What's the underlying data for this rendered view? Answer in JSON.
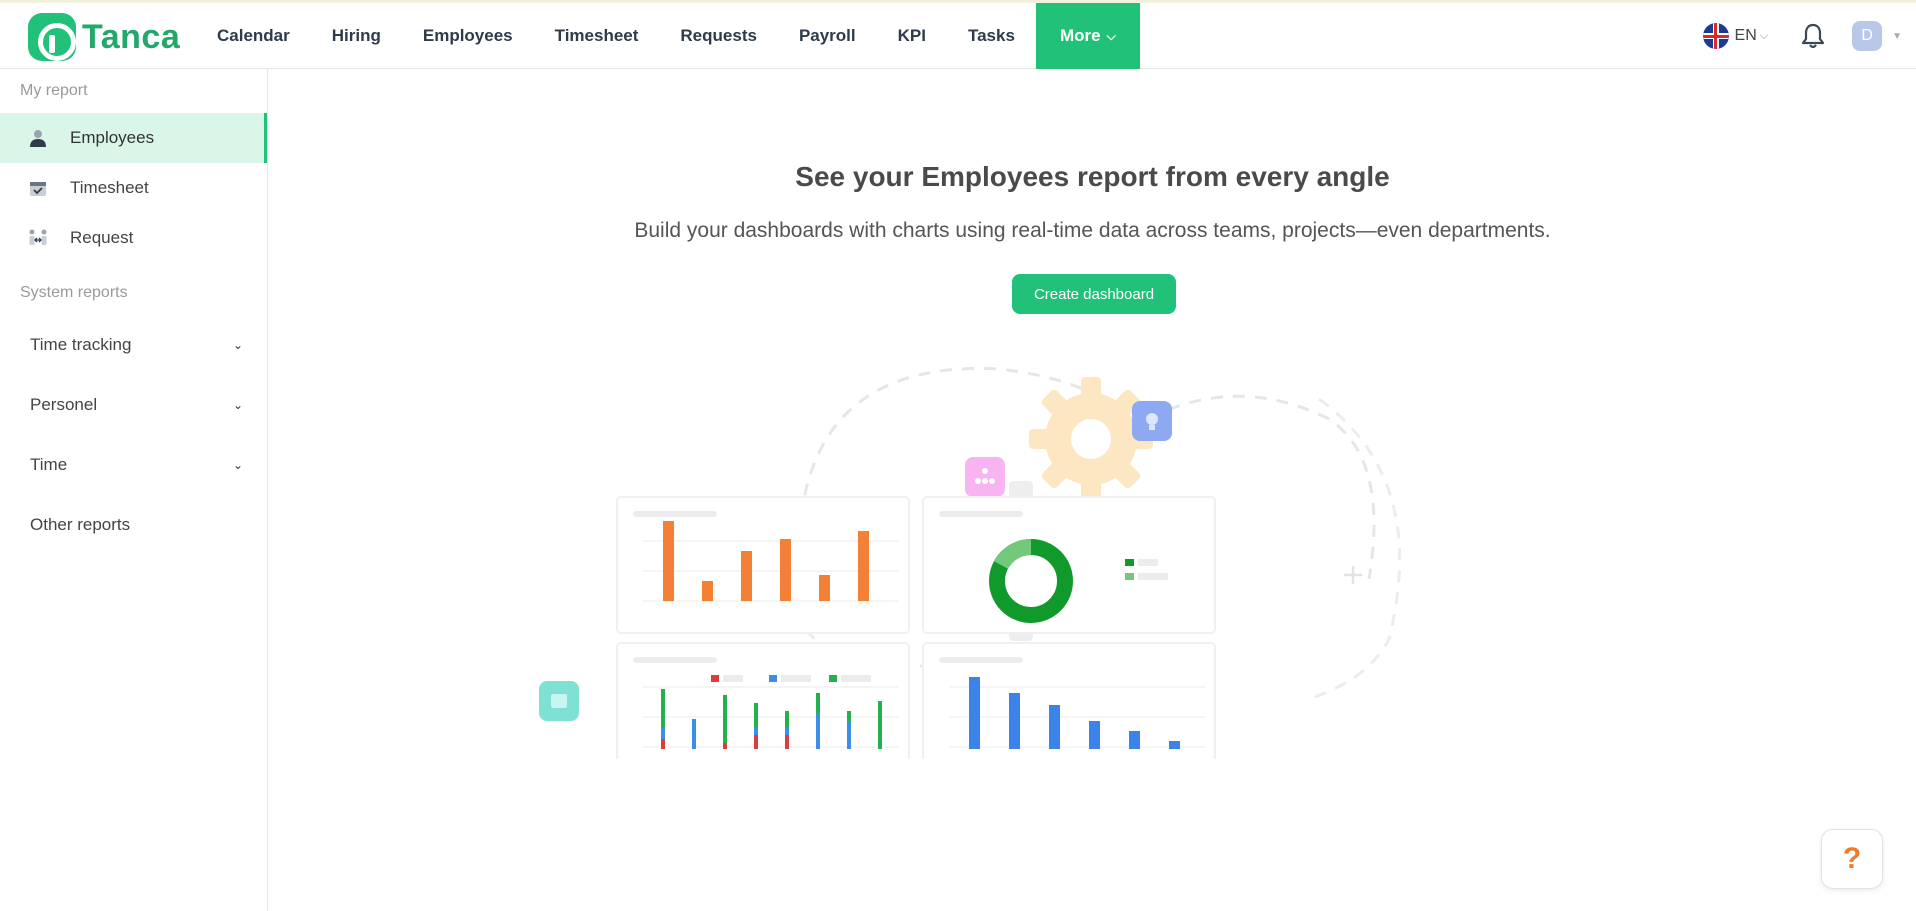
{
  "brand": {
    "name": "Tanca"
  },
  "nav": {
    "items": [
      {
        "label": "Calendar"
      },
      {
        "label": "Hiring"
      },
      {
        "label": "Employees"
      },
      {
        "label": "Timesheet"
      },
      {
        "label": "Requests"
      },
      {
        "label": "Payroll"
      },
      {
        "label": "KPI"
      },
      {
        "label": "Tasks"
      }
    ],
    "more_label": "More"
  },
  "header": {
    "language": "EN",
    "avatar_initial": "D"
  },
  "sidebar": {
    "my_report_title": "My report",
    "my_report_items": [
      {
        "label": "Employees",
        "icon": "user-icon"
      },
      {
        "label": "Timesheet",
        "icon": "calendar-check-icon"
      },
      {
        "label": "Request",
        "icon": "exchange-icon"
      }
    ],
    "system_reports_title": "System reports",
    "system_items": [
      {
        "label": "Time tracking"
      },
      {
        "label": "Personel"
      },
      {
        "label": "Time"
      }
    ],
    "other_reports_label": "Other reports"
  },
  "main": {
    "headline": "See your Employees report from every angle",
    "subline": "Build your dashboards with charts using real-time data across teams, projects—even departments.",
    "cta_label": "Create dashboard"
  },
  "help": {
    "label": "?"
  },
  "colors": {
    "accent": "#21c17a",
    "orange": "#f07a2b",
    "blue": "#2f7ae5",
    "green": "#1a9e3a",
    "red": "#e03b3b"
  }
}
